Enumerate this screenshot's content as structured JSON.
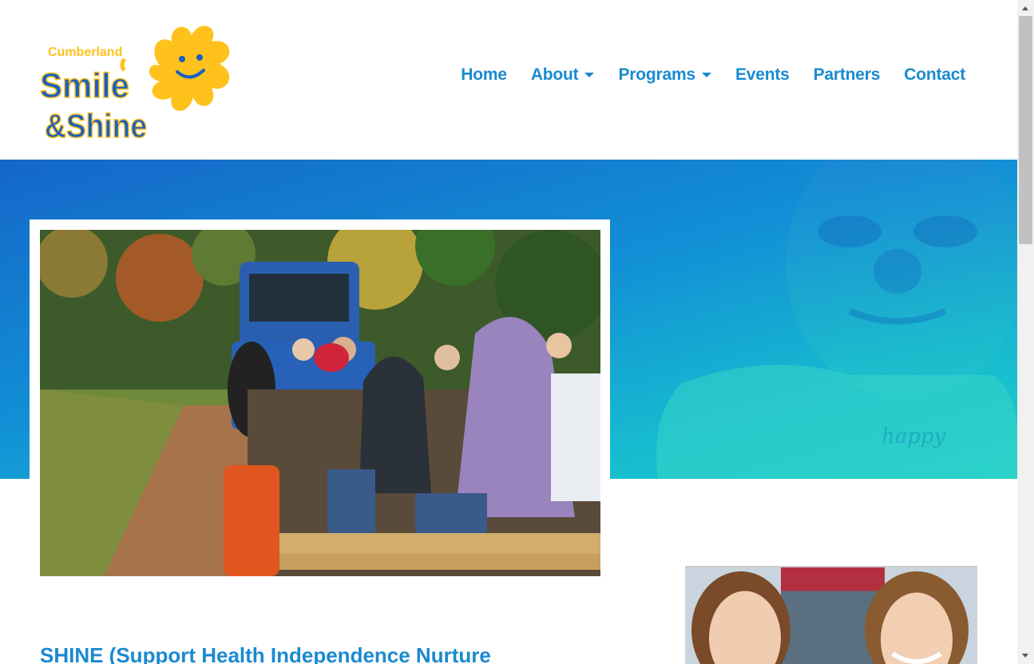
{
  "logo": {
    "line1": "Cumberland",
    "line2": "Smile",
    "line3": "&Shine",
    "colors": {
      "blue": "#1a5fc4",
      "yellow": "#ffc21c"
    }
  },
  "nav": {
    "items": [
      {
        "label": "Home",
        "dropdown": false
      },
      {
        "label": "About",
        "dropdown": true
      },
      {
        "label": "Programs",
        "dropdown": true
      },
      {
        "label": "Events",
        "dropdown": false
      },
      {
        "label": "Partners",
        "dropdown": false
      },
      {
        "label": "Contact",
        "dropdown": false
      }
    ],
    "color": "#1a8ad0"
  },
  "hero": {
    "shirt_text": "happy",
    "colors": {
      "start": "#1467c9",
      "end": "#1bcfc8"
    }
  },
  "main": {
    "heading": "SHINE (Support Health Independence Nurture"
  }
}
